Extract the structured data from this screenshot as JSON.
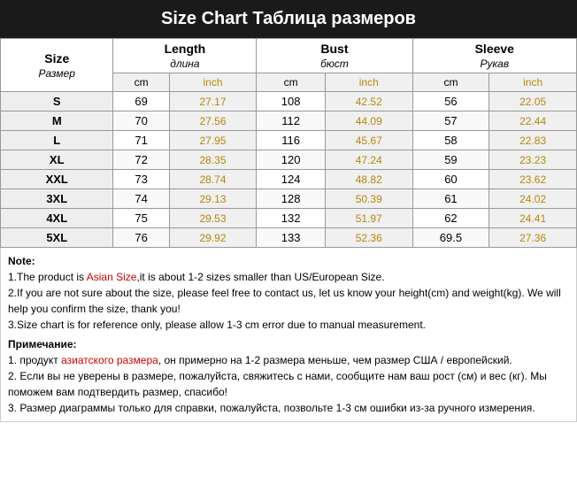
{
  "header": {
    "title": "Size Chart  Таблица размеров"
  },
  "table": {
    "columns": [
      {
        "main": "Size\nРазмер",
        "sub": ""
      },
      {
        "main": "Length\nдлина",
        "sub": ""
      },
      {
        "main": "",
        "sub": ""
      },
      {
        "main": "Bust\nбюст",
        "sub": ""
      },
      {
        "main": "",
        "sub": ""
      },
      {
        "main": "Sleeve\nРукав",
        "sub": ""
      },
      {
        "main": "",
        "sub": ""
      }
    ],
    "units": [
      "",
      "cm",
      "inch",
      "cm",
      "inch",
      "cm",
      "inch"
    ],
    "rows": [
      {
        "size": "S",
        "length_cm": "69",
        "length_in": "27.17",
        "bust_cm": "108",
        "bust_in": "42.52",
        "sleeve_cm": "56",
        "sleeve_in": "22.05"
      },
      {
        "size": "M",
        "length_cm": "70",
        "length_in": "27.56",
        "bust_cm": "112",
        "bust_in": "44.09",
        "sleeve_cm": "57",
        "sleeve_in": "22.44"
      },
      {
        "size": "L",
        "length_cm": "71",
        "length_in": "27.95",
        "bust_cm": "116",
        "bust_in": "45.67",
        "sleeve_cm": "58",
        "sleeve_in": "22.83"
      },
      {
        "size": "XL",
        "length_cm": "72",
        "length_in": "28.35",
        "bust_cm": "120",
        "bust_in": "47.24",
        "sleeve_cm": "59",
        "sleeve_in": "23.23"
      },
      {
        "size": "XXL",
        "length_cm": "73",
        "length_in": "28.74",
        "bust_cm": "124",
        "bust_in": "48.82",
        "sleeve_cm": "60",
        "sleeve_in": "23.62"
      },
      {
        "size": "3XL",
        "length_cm": "74",
        "length_in": "29.13",
        "bust_cm": "128",
        "bust_in": "50.39",
        "sleeve_cm": "61",
        "sleeve_in": "24.02"
      },
      {
        "size": "4XL",
        "length_cm": "75",
        "length_in": "29.53",
        "bust_cm": "132",
        "bust_in": "51.97",
        "sleeve_cm": "62",
        "sleeve_in": "24.41"
      },
      {
        "size": "5XL",
        "length_cm": "76",
        "length_in": "29.92",
        "bust_cm": "133",
        "bust_in": "52.36",
        "sleeve_cm": "69.5",
        "sleeve_in": "27.36"
      }
    ]
  },
  "notes": {
    "title_en": "Note:",
    "note1_prefix": "1.The product is ",
    "note1_highlight": "Asian Size",
    "note1_suffix": ",it is about 1-2 sizes smaller than US/European Size.",
    "note2": "2.If you are not sure about the size, please feel free to contact us, let us know your height(cm) and weight(kg). We will help you confirm the size, thank you!",
    "note3": "3.Size chart is for reference only, please allow 1-3 cm error due to manual measurement.",
    "title_ru": "Примечание:",
    "note1_ru_prefix": "1. продукт ",
    "note1_ru_highlight": "азиатского размера",
    "note1_ru_suffix": ", он примерно на 1-2 размера меньше, чем размер США / европейский.",
    "note2_ru": "2. Если вы не уверены в размере, пожалуйста, свяжитесь с нами, сообщите нам ваш рост (см) и вес (кг). Мы поможем вам подтвердить размер, спасибо!",
    "note3_ru": "3. Размер диаграммы только для справки, пожалуйста, позвольте 1-3 см ошибки из-за ручного измерения."
  }
}
